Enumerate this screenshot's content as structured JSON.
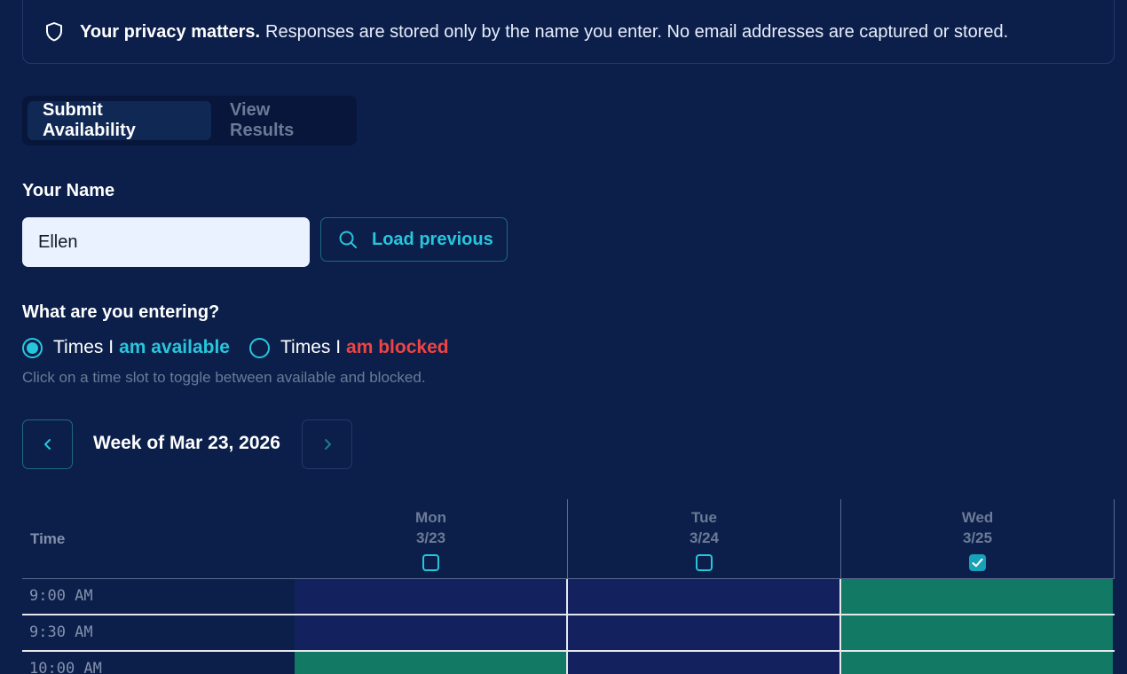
{
  "privacy": {
    "icon": "shield-icon",
    "bold": "Your privacy matters.",
    "text": "Responses are stored only by the name you enter. No email addresses are captured or stored."
  },
  "tabs": [
    {
      "label": "Submit Availability",
      "active": true
    },
    {
      "label": "View Results",
      "active": false
    }
  ],
  "name": {
    "label": "Your Name",
    "value": "Ellen",
    "load_button": "Load previous"
  },
  "entry_mode": {
    "label": "What are you entering?",
    "options": [
      {
        "prefix": "Times I",
        "emphasis": "am available",
        "selected": true
      },
      {
        "prefix": "Times I",
        "emphasis": "am blocked",
        "selected": false
      }
    ],
    "hint": "Click on a time slot to toggle between available and blocked."
  },
  "week": {
    "label": "Week of Mar 23, 2026"
  },
  "grid": {
    "time_header": "Time",
    "days": [
      {
        "name": "Mon",
        "date": "3/23",
        "checked": false
      },
      {
        "name": "Tue",
        "date": "3/24",
        "checked": false
      },
      {
        "name": "Wed",
        "date": "3/25",
        "checked": true
      }
    ],
    "rows": [
      {
        "time": "9:00 AM",
        "slots": [
          "blocked",
          "blocked",
          "available"
        ]
      },
      {
        "time": "9:30 AM",
        "slots": [
          "blocked",
          "blocked",
          "available"
        ]
      },
      {
        "time": "10:00 AM",
        "slots": [
          "available",
          "blocked",
          "available"
        ]
      }
    ]
  },
  "colors": {
    "background": "#0b1f4a",
    "accent": "#27c6dc",
    "available": "#127a64",
    "blocked_cell": "#13225e",
    "blocked_text": "#ef4444"
  }
}
